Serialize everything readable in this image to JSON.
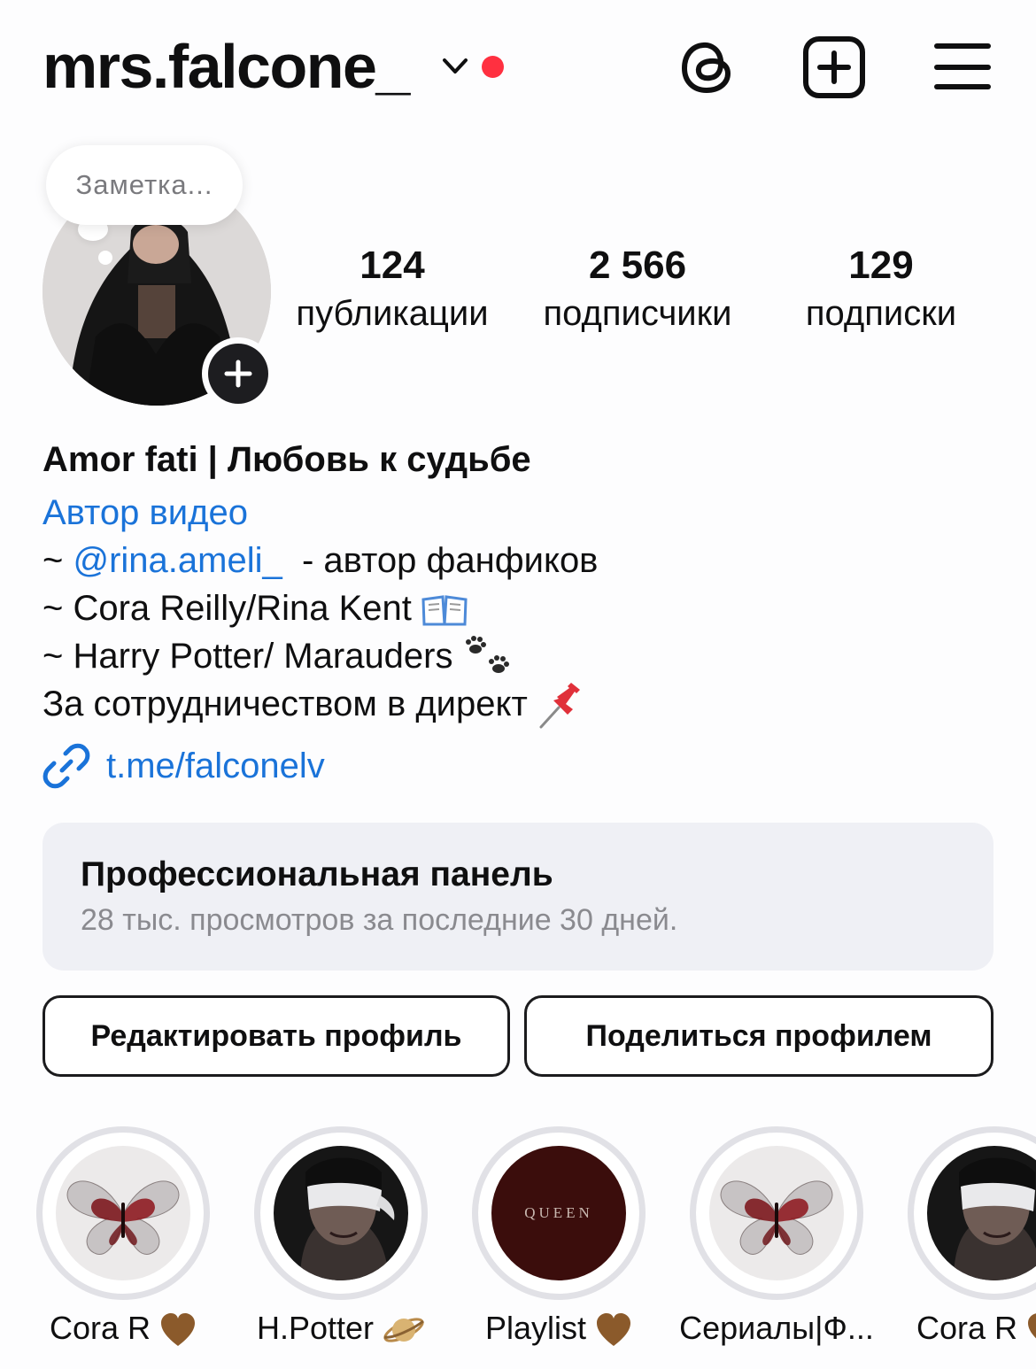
{
  "header": {
    "username": "mrs.falcone_",
    "icons": [
      "chevron-down-icon",
      "threads-icon",
      "create-post-icon",
      "menu-icon"
    ],
    "notification_dot_color": "#ff3040"
  },
  "note": {
    "placeholder": "Заметка..."
  },
  "stats": [
    {
      "value": "124",
      "label": "публикации"
    },
    {
      "value": "2 566",
      "label": "подписчики"
    },
    {
      "value": "129",
      "label": "подписки"
    }
  ],
  "bio": {
    "display_name": "Amor fati | Любовь к судьбе",
    "category": "Автор видео",
    "line1_prefix": "~ ",
    "line1_mention": "@rina.ameli_",
    "line1_suffix": "  - автор фанфиков",
    "line2": "~ Cora Reilly/Rina Kent",
    "line3": "~ Harry Potter/ Marauders",
    "line4": "За сотрудничеством в директ",
    "line_icons": [
      "book-icon",
      "paw-prints-icon",
      "pushpin-icon"
    ],
    "link": "t.me/falconelv",
    "link_color": "#1a73d9"
  },
  "dashboard": {
    "title": "Профессиональная панель",
    "subtitle": "28 тыс. просмотров за последние 30 дней."
  },
  "buttons": {
    "edit_profile": "Редактировать профиль",
    "share_profile": "Поделиться профилем"
  },
  "highlights": [
    {
      "label": "Cora R",
      "icon": "brown-heart-icon",
      "cover": "butterfly-cover"
    },
    {
      "label": "H.Potter",
      "icon": "ringed-planet-icon",
      "cover": "blindfold-cover"
    },
    {
      "label": "Playlist",
      "icon": "brown-heart-icon",
      "cover": "queen-cover",
      "cover_text": "QUEEN"
    },
    {
      "label": "Сериалы|Ф...",
      "icon": "",
      "cover": "butterfly-cover"
    },
    {
      "label": "Cora R",
      "icon": "brown-heart-icon",
      "cover": "blindfold-cover"
    }
  ]
}
